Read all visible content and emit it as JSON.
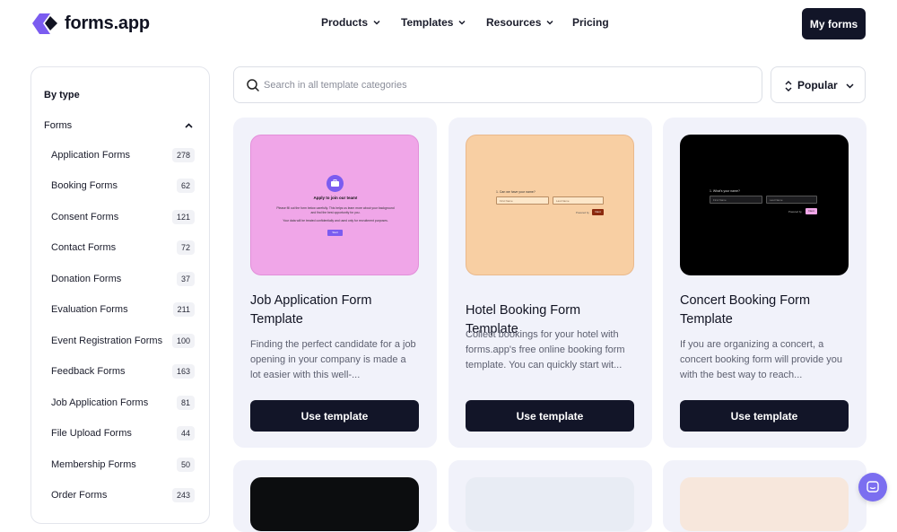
{
  "brand": {
    "name": "forms.app",
    "primary_color": "#7b5cf0",
    "dark_color": "#121528"
  },
  "nav": {
    "products": "Products",
    "templates": "Templates",
    "resources": "Resources",
    "pricing": "Pricing",
    "my_forms": "My forms"
  },
  "sidebar": {
    "by_type": "By type",
    "forms_group": "Forms",
    "items": [
      {
        "label": "Application Forms",
        "count": "278"
      },
      {
        "label": "Booking Forms",
        "count": "62"
      },
      {
        "label": "Consent Forms",
        "count": "121"
      },
      {
        "label": "Contact Forms",
        "count": "72"
      },
      {
        "label": "Donation Forms",
        "count": "37"
      },
      {
        "label": "Evaluation Forms",
        "count": "211"
      },
      {
        "label": "Event Registration Forms",
        "count": "100"
      },
      {
        "label": "Feedback Forms",
        "count": "163"
      },
      {
        "label": "Job Application Forms",
        "count": "81"
      },
      {
        "label": "File Upload Forms",
        "count": "44"
      },
      {
        "label": "Membership Forms",
        "count": "50"
      },
      {
        "label": "Order Forms",
        "count": "243"
      }
    ]
  },
  "search": {
    "placeholder": "Search in all template categories",
    "value": ""
  },
  "sort": {
    "label": "Popular"
  },
  "cards": [
    {
      "title": "Job Application Form Template",
      "desc": "Finding the perfect candidate for a job opening in your company is made a lot easier with this well-...",
      "button": "Use template",
      "thumb_color": "#f0a6e8",
      "preview": {
        "heading": "Apply to join our team!",
        "text1": "Please fill out the form below carefully. This helps us learn more about your background and find the best opportunity for you.",
        "text2": "Your data will be treated confidentially and used only for recruitment purposes.",
        "button": "Start"
      }
    },
    {
      "title": "Hotel Booking Form Template",
      "desc": "Collect bookings for your hotel with forms.app's free online booking form template. You can quickly start wit...",
      "button": "Use template",
      "thumb_color": "#f8cfa3",
      "preview": {
        "question": "1.  Can we have your name?",
        "first": "First Name",
        "last": "Last Name",
        "powered": "Powered by",
        "button": "Next"
      }
    },
    {
      "title": "Concert Booking Form Template",
      "desc": "If you are organizing a concert, a concert booking form will provide you with the best way to reach...",
      "button": "Use template",
      "thumb_color": "#000000",
      "preview": {
        "question": "1.  What's your name?",
        "first": "First Name",
        "last": "Last Name",
        "powered": "Powered by",
        "button": "Next"
      }
    }
  ],
  "row2_thumb_colors": [
    "#0c0d0f",
    "#e8ecf4",
    "#f7e7dc"
  ]
}
